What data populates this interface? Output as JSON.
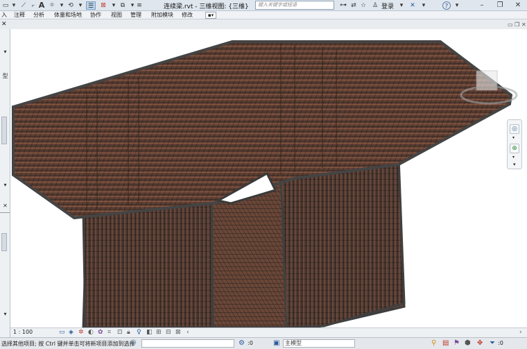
{
  "title_bar": {
    "document_title": "连续梁.rvt - 三维视图: {三维}",
    "search_placeholder": "键入关键字或短语",
    "login_label": "登录",
    "help_label": "?"
  },
  "ribbon": {
    "tabs": [
      "入",
      "注释",
      "分析",
      "体量和场地",
      "协作",
      "视图",
      "管理",
      "附加模块",
      "修改"
    ]
  },
  "left_panel": {
    "label_type": "型"
  },
  "view_control": {
    "scale": "1 : 100"
  },
  "status_bar": {
    "message": "选择其他项目; 按 Ctrl 键并单击可将新项目添加到选择",
    "workset_value": ":0",
    "model_value": "主模型",
    "filter_value": ":0"
  },
  "colors": {
    "rebar": "#7a4a35",
    "rebar_dark": "#3a2a24",
    "slab_edge": "#4a4a4a",
    "titlebar": "#dfe6ee",
    "ribbon": "#f0f2f5"
  },
  "icons": [
    "save-icon",
    "undo-icon",
    "redo-icon",
    "measure-icon",
    "text-icon",
    "3d-view-icon",
    "binoculars-icon",
    "exchange-icon",
    "star-icon",
    "user-icon",
    "x-icon",
    "help-icon",
    "view-cube-icon",
    "navigation-wheel-icon",
    "zoom-icon",
    "filter-icon"
  ]
}
